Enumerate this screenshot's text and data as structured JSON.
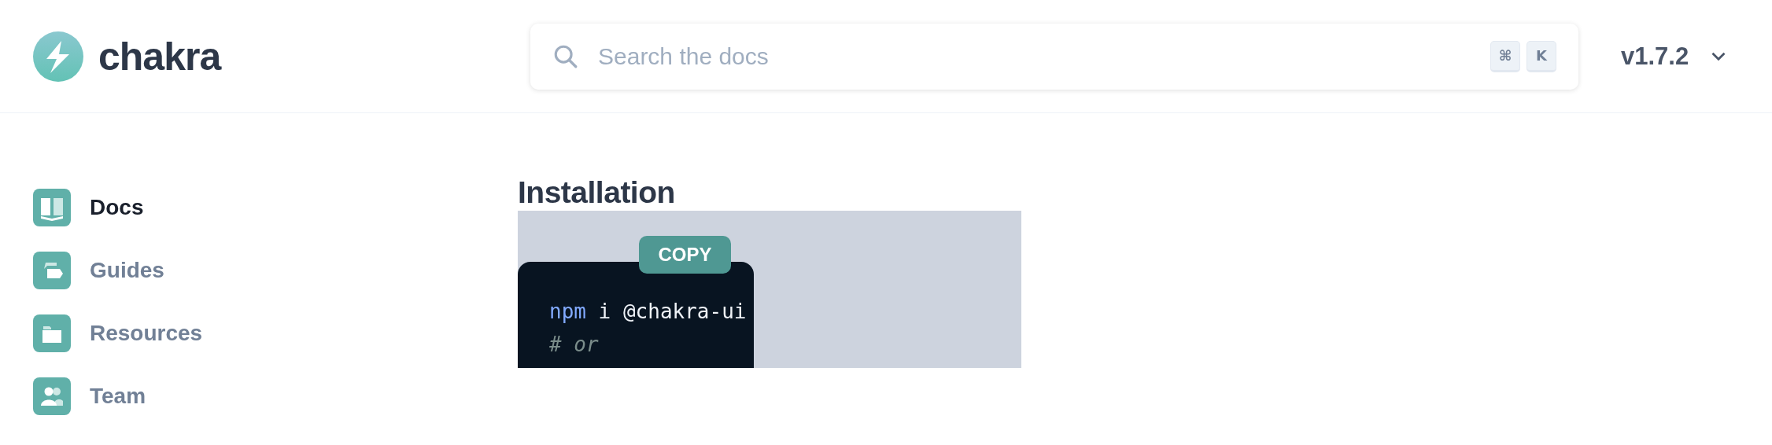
{
  "header": {
    "logo_text": "chakra",
    "search": {
      "placeholder": "Search the docs",
      "shortcut_keys": [
        "⌘",
        "K"
      ]
    },
    "version": "v1.7.2"
  },
  "sidebar": {
    "items": [
      {
        "label": "Docs",
        "selected": true
      },
      {
        "label": "Guides",
        "selected": false
      },
      {
        "label": "Resources",
        "selected": false
      },
      {
        "label": "Team",
        "selected": false
      }
    ]
  },
  "content": {
    "heading": "Installation",
    "copy_button": "COPY",
    "code_lines": [
      [
        {
          "kind": "command",
          "text": "npm"
        },
        {
          "kind": "plain",
          "text": " i @chakra-ui"
        }
      ],
      [
        {
          "kind": "comment",
          "text": "# or"
        }
      ]
    ]
  }
}
